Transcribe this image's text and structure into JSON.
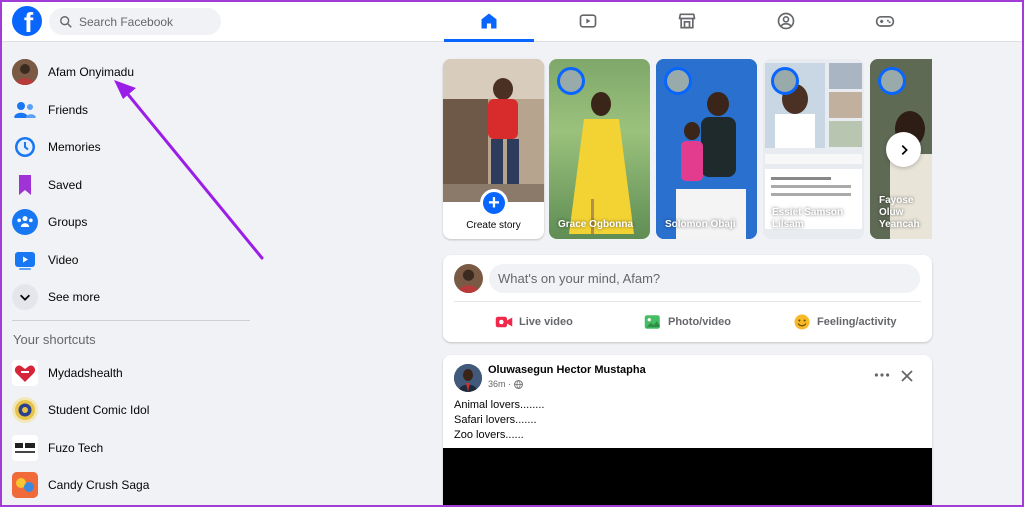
{
  "colors": {
    "accent": "#0866ff",
    "annotation_arrow": "#9b1de8",
    "frame": "#a23cd6"
  },
  "header": {
    "logo": "facebook-logo",
    "search_placeholder": "Search Facebook",
    "nav_tabs": [
      {
        "name": "home",
        "icon": "home-icon",
        "active": true
      },
      {
        "name": "watch",
        "icon": "video-play-icon",
        "active": false
      },
      {
        "name": "marketplace",
        "icon": "store-icon",
        "active": false
      },
      {
        "name": "groups",
        "icon": "people-circle-icon",
        "active": false
      },
      {
        "name": "gaming",
        "icon": "gamepad-icon",
        "active": false
      }
    ]
  },
  "sidebar": {
    "profile": {
      "label": "Afam Onyimadu",
      "icon": "profile-avatar"
    },
    "items": [
      {
        "label": "Friends",
        "icon": "friends-icon"
      },
      {
        "label": "Memories",
        "icon": "clock-icon"
      },
      {
        "label": "Saved",
        "icon": "bookmark-icon"
      },
      {
        "label": "Groups",
        "icon": "groups-icon"
      },
      {
        "label": "Video",
        "icon": "video-icon"
      },
      {
        "label": "See more",
        "icon": "chevron-down-icon"
      }
    ],
    "shortcuts_title": "Your shortcuts",
    "shortcuts": [
      {
        "label": "Mydadshealth",
        "icon": "heart-logo"
      },
      {
        "label": "Student Comic Idol",
        "icon": "badge-logo"
      },
      {
        "label": "Fuzo Tech",
        "icon": "fuzo-logo"
      },
      {
        "label": "Candy Crush Saga",
        "icon": "candy-logo"
      }
    ]
  },
  "stories": {
    "create_label": "Create story",
    "items": [
      {
        "name": "Grace Ogbonna"
      },
      {
        "name": "Solomon Obaji"
      },
      {
        "name": "Essiet Samson Lilsam"
      },
      {
        "name": "Fayose Oluw Yeancah"
      }
    ]
  },
  "composer": {
    "prompt": "What's on your mind, Afam?",
    "actions": [
      {
        "label": "Live video",
        "icon": "live-video-icon"
      },
      {
        "label": "Photo/video",
        "icon": "photo-icon"
      },
      {
        "label": "Feeling/activity",
        "icon": "smiley-icon"
      }
    ]
  },
  "post": {
    "author": "Oluwasegun Hector Mustapha",
    "time": "36m",
    "privacy_icon": "globe-icon",
    "lines": [
      "Animal lovers........",
      "Safari lovers.......",
      "Zoo lovers......"
    ]
  }
}
